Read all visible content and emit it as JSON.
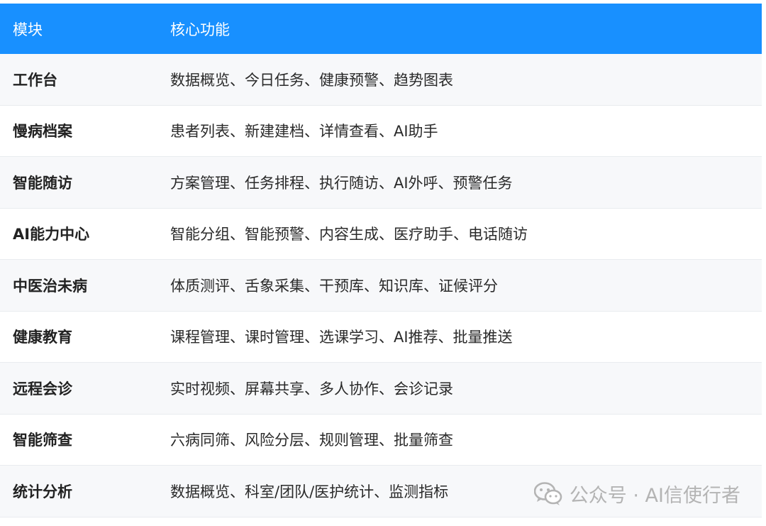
{
  "header": {
    "col_module": "模块",
    "col_function": "核心功能"
  },
  "rows": [
    {
      "module": "工作台",
      "functions": "数据概览、今日任务、健康预警、趋势图表"
    },
    {
      "module": "慢病档案",
      "functions": "患者列表、新建建档、详情查看、AI助手"
    },
    {
      "module": "智能随访",
      "functions": "方案管理、任务排程、执行随访、AI外呼、预警任务"
    },
    {
      "module": "AI能力中心",
      "functions": "智能分组、智能预警、内容生成、医疗助手、电话随访"
    },
    {
      "module": "中医治未病",
      "functions": "体质测评、舌象采集、干预库、知识库、证候评分"
    },
    {
      "module": "健康教育",
      "functions": "课程管理、课时管理、选课学习、AI推荐、批量推送"
    },
    {
      "module": "远程会诊",
      "functions": "实时视频、屏幕共享、多人协作、会诊记录"
    },
    {
      "module": "智能筛查",
      "functions": "六病同筛、风险分层、规则管理、批量筛查"
    },
    {
      "module": "统计分析",
      "functions": "数据概览、科室/团队/医护统计、监测指标"
    }
  ],
  "watermark": {
    "text": "公众号 · AI信使行者",
    "icon": "wechat-icon"
  },
  "colors": {
    "header_bg": "#1890ff",
    "alt_row_bg": "#f7f8fa"
  }
}
